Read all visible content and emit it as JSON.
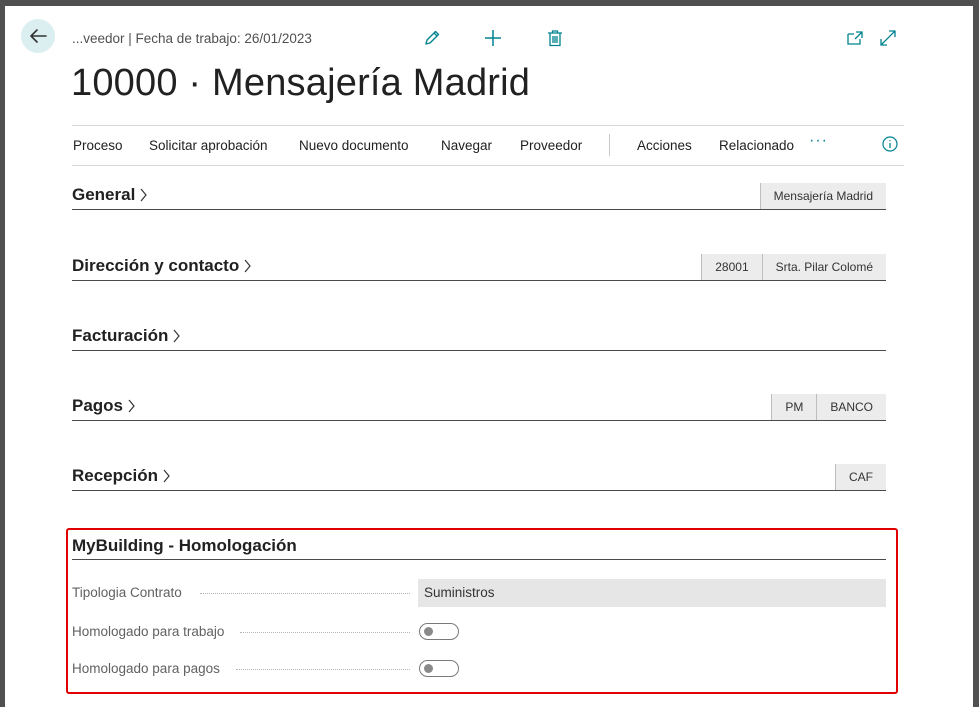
{
  "header": {
    "breadcrumb": "...veedor | Fecha de trabajo: 26/01/2023",
    "title": "10000 · Mensajería Madrid"
  },
  "actions": {
    "edit_icon": "pencil-icon",
    "add_icon": "plus-icon",
    "delete_icon": "trash-icon",
    "open_new_window_icon": "open-in-new-window-icon",
    "expand_icon": "expand-icon"
  },
  "menu": {
    "items": [
      "Proceso",
      "Solicitar aprobación",
      "Nuevo documento",
      "Navegar",
      "Proveedor",
      "Acciones",
      "Relacionado"
    ],
    "more": "···"
  },
  "sections": [
    {
      "title": "General",
      "chips": [
        "Mensajería Madrid"
      ]
    },
    {
      "title": "Dirección y contacto",
      "chips": [
        "28001",
        "Srta. Pilar Colomé"
      ]
    },
    {
      "title": "Facturación",
      "chips": []
    },
    {
      "title": "Pagos",
      "chips": [
        "PM",
        "BANCO"
      ]
    },
    {
      "title": "Recepción",
      "chips": [
        "CAF"
      ]
    }
  ],
  "mybuilding": {
    "title": "MyBuilding - Homologación",
    "fields": [
      {
        "label": "Tipologia Contrato",
        "value": "Suministros"
      },
      {
        "label": "Homologado para trabajo",
        "value": false
      },
      {
        "label": "Homologado para pagos",
        "value": false
      }
    ]
  },
  "colors": {
    "accent": "#00838f",
    "highlight": "#e00000"
  }
}
